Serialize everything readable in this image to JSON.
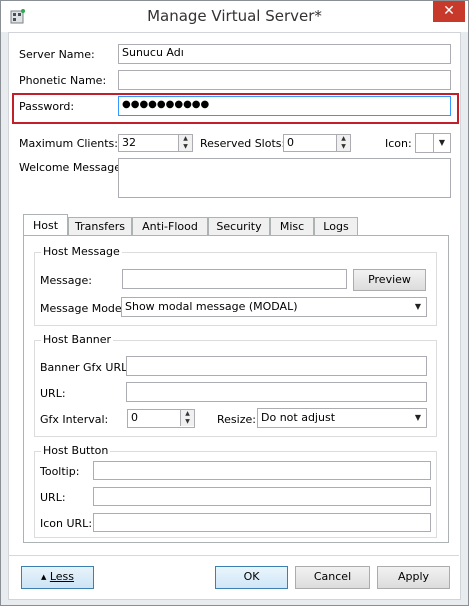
{
  "window": {
    "title": "Manage Virtual Server*"
  },
  "labels": {
    "server_name": "Server Name:",
    "phonetic_name": "Phonetic Name:",
    "password": "Password:",
    "max_clients": "Maximum Clients:",
    "reserved_slots": "Reserved Slots:",
    "icon": "Icon:",
    "welcome": "Welcome Message:"
  },
  "fields": {
    "server_name": "Sunucu Adı",
    "phonetic_name": "",
    "password": "●●●●●●●●●●",
    "max_clients": "32",
    "reserved_slots": "0",
    "welcome": ""
  },
  "tabs": [
    "Host",
    "Transfers",
    "Anti-Flood",
    "Security",
    "Misc",
    "Logs"
  ],
  "host_message": {
    "title": "Host Message",
    "message_label": "Message:",
    "message_value": "",
    "preview_label": "Preview",
    "mode_label": "Message Mode:",
    "mode_value": "Show modal message (MODAL)"
  },
  "host_banner": {
    "title": "Host Banner",
    "gfx_url_label": "Banner Gfx URL:",
    "url_label": "URL:",
    "interval_label": "Gfx Interval:",
    "interval_value": "0",
    "resize_label": "Resize:",
    "resize_value": "Do not adjust"
  },
  "host_button": {
    "title": "Host Button",
    "tooltip_label": "Tooltip:",
    "url_label": "URL:",
    "icon_url_label": "Icon URL:"
  },
  "buttons": {
    "less": "Less",
    "ok": "OK",
    "cancel": "Cancel",
    "apply": "Apply"
  },
  "colors": {
    "highlight": "#c0202a",
    "close": "#c7392a"
  }
}
